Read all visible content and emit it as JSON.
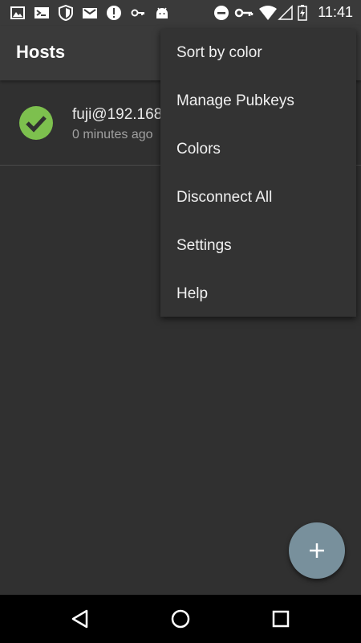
{
  "status_bar": {
    "time": "11:41",
    "icons": [
      "image-icon",
      "terminal-icon",
      "shield-icon",
      "gmail-icon",
      "alert-icon",
      "key-icon",
      "android-icon",
      "do-not-disturb-icon",
      "vpn-key-icon",
      "wifi-icon",
      "no-signal-icon",
      "battery-charging-icon"
    ]
  },
  "app_bar": {
    "title": "Hosts"
  },
  "hosts": [
    {
      "name": "fuji@192.168",
      "subtitle": "0 minutes ago",
      "status_color": "#7dc04e"
    }
  ],
  "overflow_menu": {
    "items": [
      {
        "label": "Sort by color"
      },
      {
        "label": "Manage Pubkeys"
      },
      {
        "label": "Colors"
      },
      {
        "label": "Disconnect All"
      },
      {
        "label": "Settings"
      },
      {
        "label": "Help"
      }
    ]
  },
  "fab": {
    "icon": "add-icon",
    "color": "#78909c"
  },
  "nav_bar": {
    "buttons": [
      "back-icon",
      "home-icon",
      "recents-icon"
    ]
  }
}
